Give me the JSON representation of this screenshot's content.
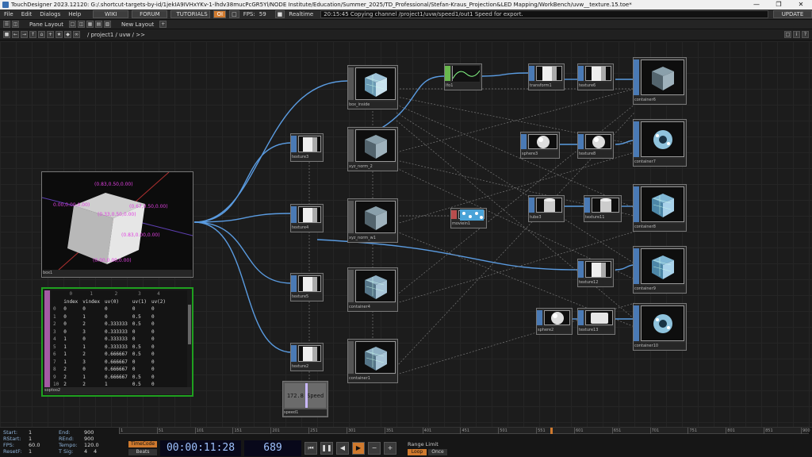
{
  "window": {
    "title": "TouchDesigner 2023.12120: G:/.shortcut-targets-by-id/1jekIA9IVHxYKv-1-lhdv38mucPcGR5Yl/NODE Institute/Education/Summer_2025/TD_Professional/Stefan-Kraus_Projection&LED Mapping/WorkBench/uvw__texture.15.toe*"
  },
  "menubar": {
    "items": [
      "File",
      "Edit",
      "Dialogs",
      "Help"
    ],
    "wiki": "WIKI",
    "forum": "FORUM",
    "tutorials": "TUTORIALS",
    "oi": "OI",
    "fps_label": "FPS:",
    "fps_value": "59",
    "realtime": "Realtime",
    "status_message": "20:15:45 Copying channel /project1/uvw/speed1/out1 Speed for export.",
    "update": "UPDATE"
  },
  "panebar": {
    "pane_layout": "Pane Layout",
    "new_layout": "New Layout"
  },
  "pathbar": {
    "path": "/ project1 / uvw / >>"
  },
  "viewer": {
    "labels": [
      "(0.83,0.50,0.00)",
      "(0.67,0.50,0.00)",
      "(0.33,0.50,0.00)",
      "(0.83,0.00,0.00)",
      "(0.00,0.00,0.00)",
      "0.00,0.00,0.00)"
    ],
    "name": "box1"
  },
  "table": {
    "col_numbers": [
      "0",
      "1",
      "2",
      "3",
      "4"
    ],
    "headers": [
      "index",
      "vindex",
      "uv(0)",
      "uv(1)",
      "uv(2)"
    ],
    "rows": [
      [
        "0",
        "0",
        "0",
        "0",
        "0",
        "0"
      ],
      [
        "1",
        "0",
        "1",
        "0",
        "0.5",
        "0"
      ],
      [
        "2",
        "0",
        "2",
        "0.333333",
        "0.5",
        "0"
      ],
      [
        "3",
        "0",
        "3",
        "0.333333",
        "0",
        "0"
      ],
      [
        "4",
        "1",
        "0",
        "0.333333",
        "0",
        "0"
      ],
      [
        "5",
        "1",
        "1",
        "0.333333",
        "0.5",
        "0"
      ],
      [
        "6",
        "1",
        "2",
        "0.666667",
        "0.5",
        "0"
      ],
      [
        "7",
        "1",
        "3",
        "0.666667",
        "0",
        "0"
      ],
      [
        "8",
        "2",
        "0",
        "0.666667",
        "0",
        "0"
      ],
      [
        "9",
        "2",
        "1",
        "0.666667",
        "0.5",
        "0"
      ],
      [
        "10",
        "2",
        "2",
        "1",
        "0.5",
        "0"
      ],
      [
        "11",
        "2",
        "3",
        "1",
        "0",
        "0"
      ]
    ],
    "name": "soptoo2"
  },
  "nodes": {
    "box_inside": "box_inside",
    "xyz_norm_2": "xyz_norm_2",
    "xyz_norm_w1": "xyz_norm_w1",
    "container4": "container4",
    "container1": "container1",
    "texture3": "texture3",
    "texture4": "texture4",
    "texture5": "texture5",
    "texture2": "texture2",
    "lfo1": "lfo1",
    "transform1": "transform1",
    "texture6": "texture6",
    "container6": "container6",
    "sphere3": "sphere3",
    "texture8": "texture8",
    "container7": "container7",
    "movie1": "moviein1",
    "tube3": "tube3",
    "texture11": "texture11",
    "container8": "container8",
    "texture12": "texture12",
    "container9": "container9",
    "sphere2": "sphere2",
    "texture13": "texture13",
    "container10": "container10",
    "speed1": "speed1",
    "speed_value": "172.8 Speed"
  },
  "status": {
    "start_label": "Start:",
    "start": "1",
    "end_label": "End:",
    "end": "900",
    "rstart_label": "RStart:",
    "rstart": "1",
    "rend_label": "REnd:",
    "rend": "900",
    "fps_label": "FPS:",
    "fps": "60.0",
    "tempo_label": "Tempo:",
    "tempo": "120.0",
    "resetf_label": "ResetF:",
    "resetf": "1",
    "tsig_label": "T Sig:",
    "tsig_a": "4",
    "tsig_b": "4",
    "timecode_btn": "TimeCode",
    "beats_btn": "Beats",
    "timecode": "00:00:11:28",
    "frame": "689",
    "range_limit": "Range Limit",
    "loop": "Loop",
    "once": "Once",
    "ticks": [
      "1",
      "51",
      "101",
      "151",
      "201",
      "251",
      "301",
      "351",
      "401",
      "451",
      "501",
      "551",
      "601",
      "651",
      "701",
      "751",
      "801",
      "851",
      "900"
    ]
  },
  "colors": {
    "accent_orange": "#d07a2e",
    "wire_blue": "#5a9be0",
    "viewer_label": "#e040e0",
    "table_border": "#1fa01f",
    "playhead": "#d07a2e"
  }
}
